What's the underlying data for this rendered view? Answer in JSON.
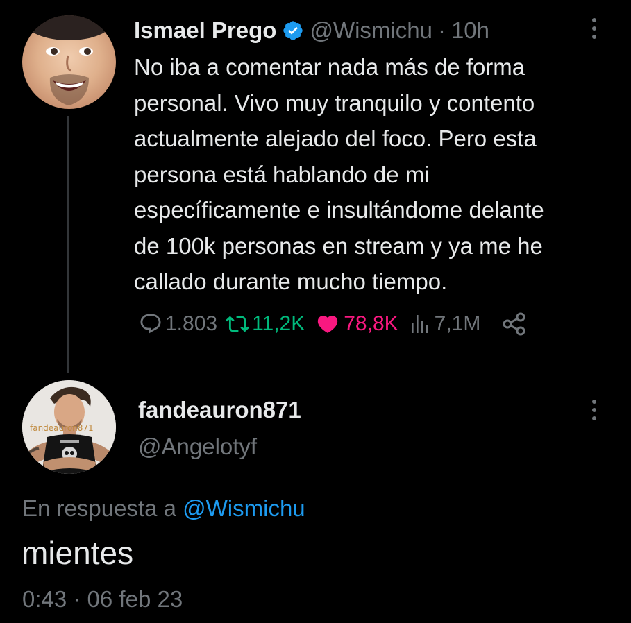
{
  "tweet": {
    "display_name": "Ismael Prego",
    "handle": "@Wismichu",
    "separator": "·",
    "time_ago": "10h",
    "text_lines": [
      "No iba a comentar nada más de forma",
      "personal. Vivo muy tranquilo y contento",
      "actualmente alejado del foco. Pero esta",
      "persona está hablando de mi",
      "específicamente e insultándome delante",
      "de 100k personas en stream y ya me he",
      "callado durante mucho tiempo."
    ],
    "stats": {
      "replies": "1.803",
      "retweets": "11,2K",
      "likes": "78,8K",
      "views": "7,1M"
    }
  },
  "reply": {
    "username": "fandeauron871",
    "handle": "@Angelotyf",
    "avatar_caption": "fandeauron871",
    "in_reply_to_label": "En respuesta a",
    "in_reply_to_handle": "@Wismichu",
    "text": "mientes",
    "timestamp": "0:43 · 06 feb 23"
  },
  "colors": {
    "background": "#000000",
    "text": "#e7e9ea",
    "muted": "#71767b",
    "link": "#1d9bf0",
    "verified": "#1d9bf0",
    "retweet": "#00ba7c",
    "like": "#f91880"
  },
  "icons": [
    "verified-badge-icon",
    "more-options-icon",
    "reply-bubble-icon",
    "retweet-arrows-icon",
    "heart-icon",
    "views-bars-icon",
    "share-icon"
  ]
}
